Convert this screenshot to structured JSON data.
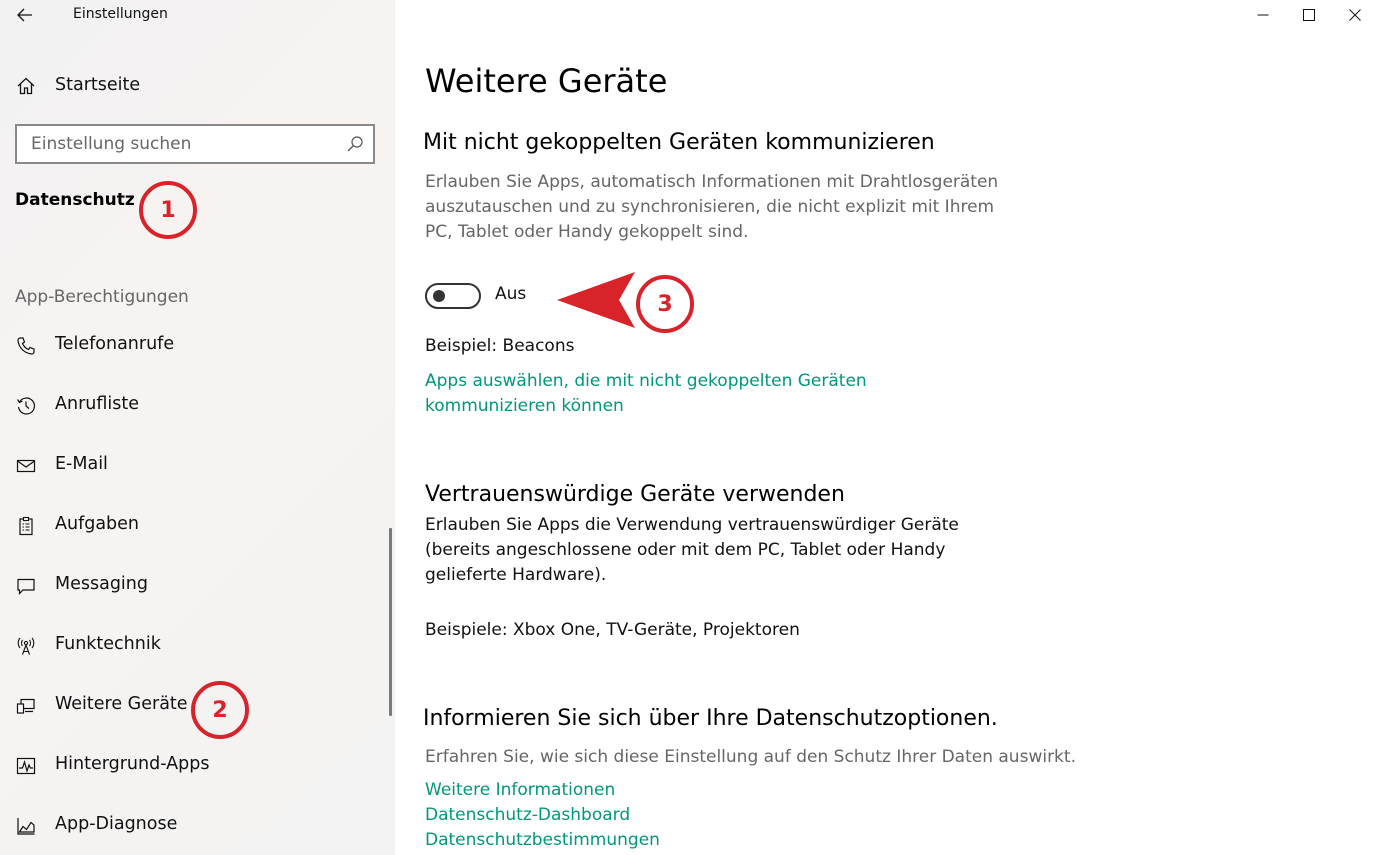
{
  "window": {
    "title": "Einstellungen",
    "controls": [
      "minimize",
      "maximize",
      "close"
    ]
  },
  "sidebar": {
    "home_label": "Startseite",
    "search_placeholder": "Einstellung suchen",
    "section_title": "Datenschutz",
    "group_label": "App-Berechtigungen",
    "items": [
      {
        "label": "Telefonanrufe",
        "icon": "phone-icon"
      },
      {
        "label": "Anrufliste",
        "icon": "history-icon"
      },
      {
        "label": "E-Mail",
        "icon": "mail-icon"
      },
      {
        "label": "Aufgaben",
        "icon": "clipboard-icon"
      },
      {
        "label": "Messaging",
        "icon": "chat-icon"
      },
      {
        "label": "Funktechnik",
        "icon": "radio-tower-icon"
      },
      {
        "label": "Weitere Geräte",
        "icon": "devices-icon"
      },
      {
        "label": "Hintergrund-Apps",
        "icon": "background-apps-icon"
      },
      {
        "label": "App-Diagnose",
        "icon": "diagnostics-icon"
      }
    ]
  },
  "annotations": {
    "badge1": "1",
    "badge2": "2",
    "badge3": "3",
    "color": "#d8232a"
  },
  "main": {
    "title": "Weitere Geräte",
    "section1": {
      "heading": "Mit nicht gekoppelten Geräten kommunizieren",
      "desc_lines": [
        "Erlauben Sie Apps, automatisch Informationen mit Drahtlosgeräten",
        "auszutauschen und zu synchronisieren, die nicht explizit mit Ihrem",
        "PC, Tablet oder Handy gekoppelt sind."
      ],
      "toggle_state": "Aus",
      "toggle_on": false,
      "example": "Beispiel: Beacons",
      "link_lines": [
        "Apps auswählen, die mit nicht gekoppelten Geräten",
        "kommunizieren können"
      ]
    },
    "section2": {
      "heading": "Vertrauenswürdige Geräte verwenden",
      "desc_lines": [
        "Erlauben Sie Apps die Verwendung vertrauenswürdiger Geräte",
        "(bereits angeschlossene oder mit dem PC, Tablet oder Handy",
        "gelieferte Hardware)."
      ],
      "example": "Beispiele: Xbox One, TV-Geräte, Projektoren"
    },
    "section3": {
      "heading": "Informieren Sie sich über Ihre Datenschutzoptionen.",
      "desc": "Erfahren Sie, wie sich diese Einstellung auf den Schutz Ihrer Daten auswirkt.",
      "links": [
        "Weitere Informationen",
        "Datenschutz-Dashboard",
        "Datenschutzbestimmungen"
      ]
    },
    "link_color": "#00977b"
  }
}
